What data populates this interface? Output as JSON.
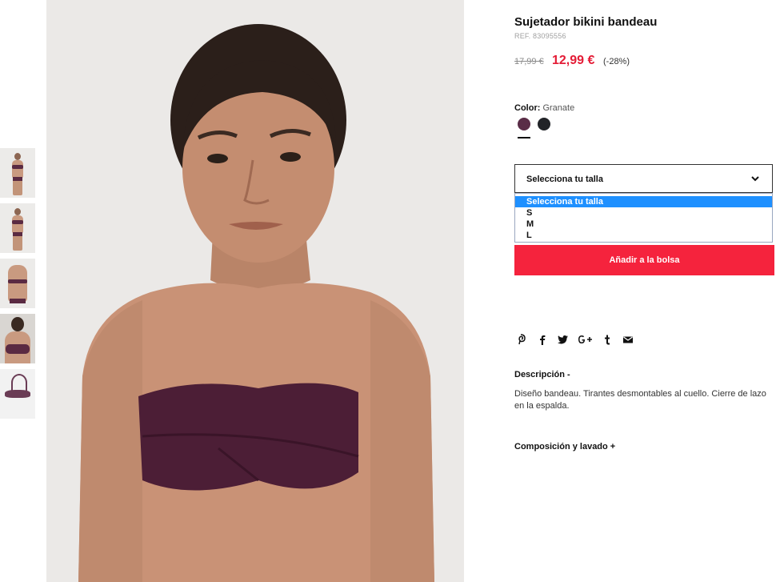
{
  "product": {
    "title": "Sujetador bikini bandeau",
    "ref": "REF. 83095556",
    "old_price": "17,99 €",
    "new_price": "12,99 €",
    "discount": "(-28%)"
  },
  "color": {
    "label": "Color:",
    "value": "Granate",
    "swatches": [
      {
        "name": "Granate",
        "hex": "#5a2d47",
        "selected": true
      },
      {
        "name": "Negro",
        "hex": "#222428",
        "selected": false
      }
    ]
  },
  "size_select": {
    "value": "Selecciona tu talla",
    "options": [
      "Selecciona tu talla",
      "S",
      "M",
      "L"
    ]
  },
  "add_to_bag": "Añadir a la bolsa",
  "social_icons": [
    "pinterest-icon",
    "facebook-icon",
    "twitter-icon",
    "google-plus-icon",
    "tumblr-icon",
    "email-icon"
  ],
  "description": {
    "heading": "Descripción -",
    "text": "Diseño bandeau. Tirantes desmontables al cuello. Cierre de lazo en la espalda."
  },
  "composition": {
    "heading": "Composición y lavado +"
  },
  "colors": {
    "accent_red": "#f5233d",
    "price_red": "#e41c36",
    "highlight_blue": "#1e90ff"
  }
}
